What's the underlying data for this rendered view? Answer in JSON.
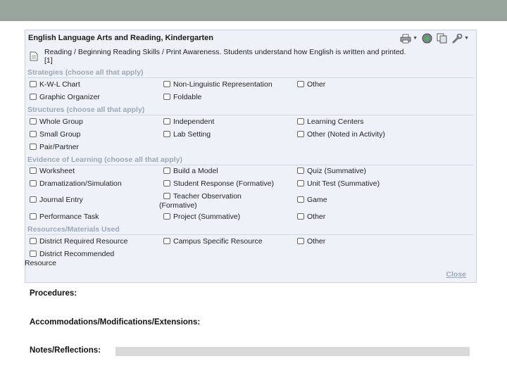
{
  "title": "English Language Arts and Reading, Kindergarten",
  "standard": "Reading / Beginning Reading Skills / Print Awareness. Students understand how English is written and printed.",
  "standard_ref": "[1]",
  "toolbar": {
    "icons": [
      "printer-icon",
      "add-icon",
      "copy-icon",
      "wrench-icon"
    ]
  },
  "sections": {
    "strategies": {
      "heading": "Strategies (choose all that apply)",
      "items": [
        "K-W-L Chart",
        "Non-Linguistic Representation",
        "Other",
        "Graphic Organizer",
        "Foldable"
      ]
    },
    "structures": {
      "heading": "Structures (choose all that apply)",
      "items": [
        "Whole Group",
        "Independent",
        "Learning Centers",
        "Small Group",
        "Lab Setting",
        "Other (Noted in Activity)",
        "Pair/Partner"
      ]
    },
    "evidence": {
      "heading": "Evidence of Learning (choose all that apply)",
      "items": [
        "Worksheet",
        "Build a Model",
        "Quiz (Summative)",
        "Dramatization/Simulation",
        "Student Response (Formative)",
        "Unit Test (Summative)",
        "Journal Entry",
        "Teacher Observation",
        "(Formative)",
        "Game",
        "Performance Task",
        "Project (Summative)",
        "Other"
      ]
    },
    "resources": {
      "heading": "Resources/Materials Used",
      "items": [
        "District Required Resource",
        "Campus Specific Resource",
        "Other",
        "District Recommended",
        "Resource"
      ]
    }
  },
  "close_label": "Close",
  "labels": {
    "procedures": "Procedures:",
    "accommodations": "Accommodations/Modifications/Extensions:",
    "notes": "Notes/Reflections:"
  }
}
